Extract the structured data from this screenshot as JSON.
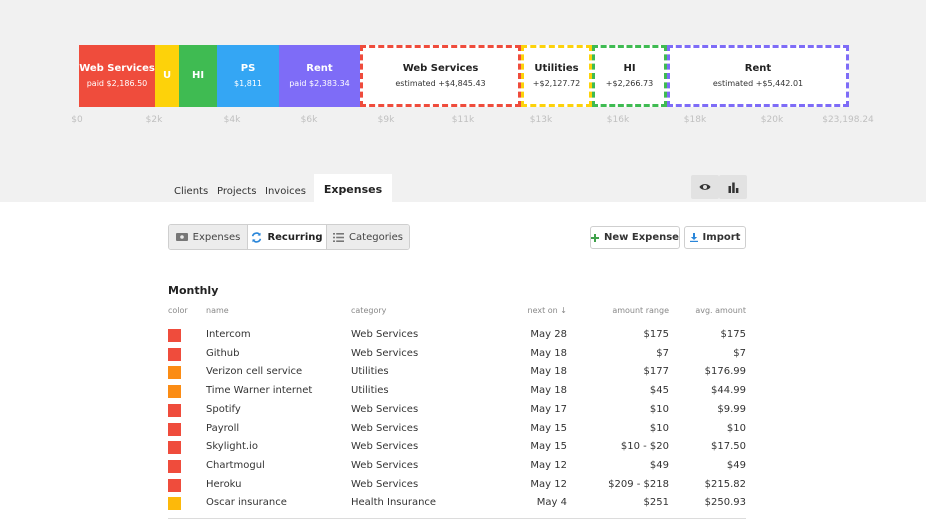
{
  "budget_bar": {
    "segments": [
      {
        "title": "Web Services",
        "sub": "paid $2,186.50",
        "color": "#ef4c3c",
        "kind": "paid"
      },
      {
        "title": "U",
        "sub": "",
        "color": "#fdd20a",
        "kind": "paid"
      },
      {
        "title": "HI",
        "sub": "",
        "color": "#3fbb52",
        "kind": "paid"
      },
      {
        "title": "PS",
        "sub": "$1,811",
        "color": "#34a6f4",
        "kind": "paid"
      },
      {
        "title": "Rent",
        "sub": "paid $2,383.34",
        "color": "#7e6cf7",
        "kind": "paid"
      },
      {
        "title": "Web Services",
        "sub": "estimated +$4,845.43",
        "color": "#ef4c3c",
        "kind": "est"
      },
      {
        "title": "Utilities",
        "sub": "+$2,127.72",
        "color": "#fdd20a",
        "kind": "est"
      },
      {
        "title": "HI",
        "sub": "+$2,266.73",
        "color": "#3fbb52",
        "kind": "est"
      },
      {
        "title": "Rent",
        "sub": "estimated +$5,442.01",
        "color": "#7e6cf7",
        "kind": "est"
      }
    ],
    "ticks": [
      "$0",
      "$2k",
      "$4k",
      "$6k",
      "$9k",
      "$11k",
      "$13k",
      "$16k",
      "$18k",
      "$20k",
      "$23,198.24"
    ]
  },
  "tabs": {
    "clients": "Clients",
    "projects": "Projects",
    "invoices": "Invoices",
    "expenses": "Expenses"
  },
  "toolbar": {
    "expenses": "Expenses",
    "recurring": "Recurring",
    "categories": "Categories",
    "new_expense": "New Expense",
    "import": "Import"
  },
  "table": {
    "section": "Monthly",
    "headers": {
      "color": "color",
      "name": "name",
      "category": "category",
      "next_on": "next on ↓",
      "amount_range": "amount range",
      "avg_amount": "avg. amount"
    },
    "rows": [
      {
        "color": "#ef4c3c",
        "name": "Intercom",
        "category": "Web Services",
        "next": "May 28",
        "range": "$175",
        "avg": "$175"
      },
      {
        "color": "#ef4c3c",
        "name": "Github",
        "category": "Web Services",
        "next": "May 18",
        "range": "$7",
        "avg": "$7"
      },
      {
        "color": "#fb8c14",
        "name": "Verizon cell service",
        "category": "Utilities",
        "next": "May 18",
        "range": "$177",
        "avg": "$176.99"
      },
      {
        "color": "#fb8c14",
        "name": "Time Warner internet",
        "category": "Utilities",
        "next": "May 18",
        "range": "$45",
        "avg": "$44.99"
      },
      {
        "color": "#ef4c3c",
        "name": "Spotify",
        "category": "Web Services",
        "next": "May 17",
        "range": "$10",
        "avg": "$9.99"
      },
      {
        "color": "#ef4c3c",
        "name": "Payroll",
        "category": "Web Services",
        "next": "May 15",
        "range": "$10",
        "avg": "$10"
      },
      {
        "color": "#ef4c3c",
        "name": "Skylight.io",
        "category": "Web Services",
        "next": "May 15",
        "range": "$10 - $20",
        "avg": "$17.50"
      },
      {
        "color": "#ef4c3c",
        "name": "Chartmogul",
        "category": "Web Services",
        "next": "May 12",
        "range": "$49",
        "avg": "$49"
      },
      {
        "color": "#ef4c3c",
        "name": "Heroku",
        "category": "Web Services",
        "next": "May 12",
        "range": "$209 - $218",
        "avg": "$215.82"
      },
      {
        "color": "#fdb90a",
        "name": "Oscar insurance",
        "category": "Health Insurance",
        "next": "May 4",
        "range": "$251",
        "avg": "$250.93"
      }
    ]
  }
}
